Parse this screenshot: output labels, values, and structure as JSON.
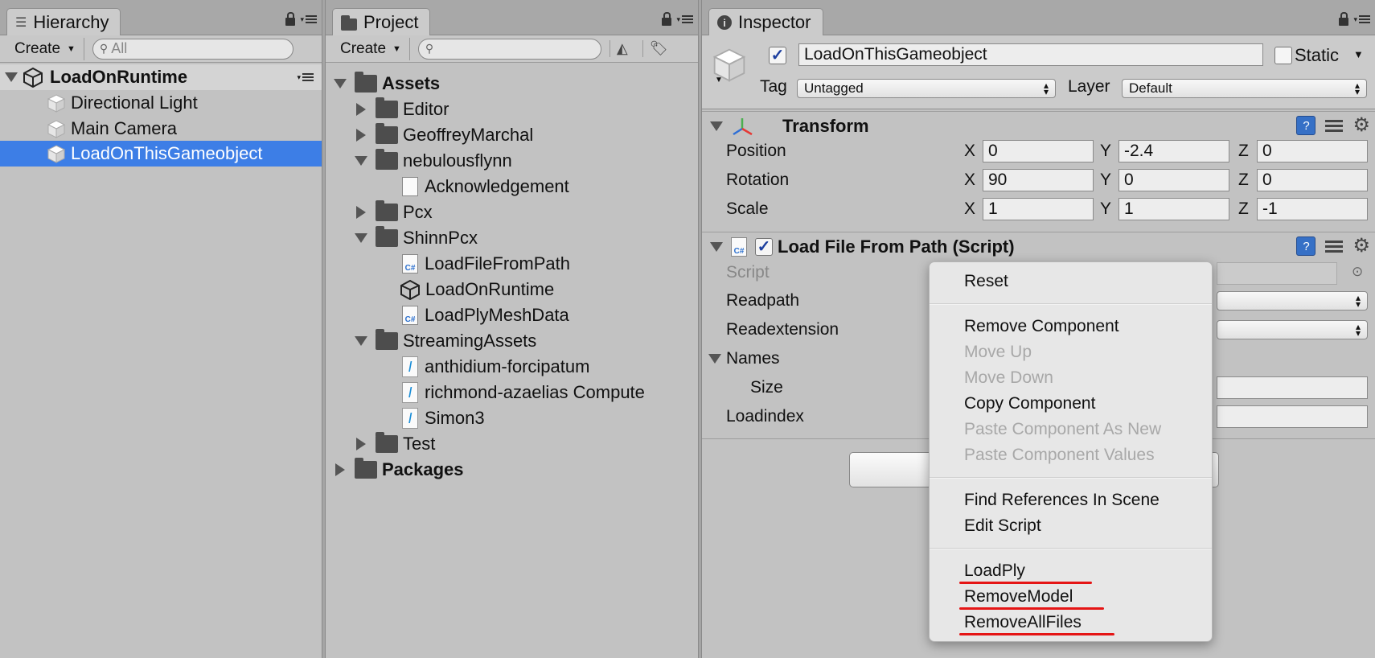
{
  "hierarchy": {
    "tab_label": "Hierarchy",
    "create_label": "Create",
    "search_placeholder": "All",
    "scene_name": "LoadOnRuntime",
    "items": [
      "Directional Light",
      "Main Camera",
      "LoadOnThisGameobject"
    ],
    "selected_index": 2
  },
  "project": {
    "tab_label": "Project",
    "create_label": "Create",
    "tree": [
      {
        "label": "Assets",
        "bold": true
      },
      {
        "label": "Editor"
      },
      {
        "label": "GeoffreyMarchal"
      },
      {
        "label": "nebulousflynn"
      },
      {
        "label": "Acknowledgement"
      },
      {
        "label": "Pcx"
      },
      {
        "label": "ShinnPcx"
      },
      {
        "label": "LoadFileFromPath"
      },
      {
        "label": "LoadOnRuntime"
      },
      {
        "label": "LoadPlyMeshData"
      },
      {
        "label": "StreamingAssets"
      },
      {
        "label": "anthidium-forcipatum"
      },
      {
        "label": "richmond-azaelias Compute"
      },
      {
        "label": "Simon3"
      },
      {
        "label": "Test"
      },
      {
        "label": "Packages",
        "bold": true
      }
    ]
  },
  "inspector": {
    "tab_label": "Inspector",
    "object_name": "LoadOnThisGameobject",
    "active": true,
    "static_label": "Static",
    "static_checked": false,
    "tag_label": "Tag",
    "tag_value": "Untagged",
    "layer_label": "Layer",
    "layer_value": "Default",
    "transform": {
      "title": "Transform",
      "axes": [
        "X",
        "Y",
        "Z"
      ],
      "rows": [
        {
          "label": "Position",
          "values": [
            "0",
            "-2.4",
            "0"
          ]
        },
        {
          "label": "Rotation",
          "values": [
            "90",
            "0",
            "0"
          ]
        },
        {
          "label": "Scale",
          "values": [
            "1",
            "1",
            "-1"
          ]
        }
      ]
    },
    "script_component": {
      "title": "Load File From Path (Script)",
      "enabled": true,
      "fields": [
        "Script",
        "Readpath",
        "Readextension",
        "Names",
        "Size",
        "Loadindex"
      ]
    }
  },
  "context_menu": {
    "items": [
      {
        "label": "Reset",
        "enabled": true
      },
      {
        "label": "Remove Component",
        "enabled": true
      },
      {
        "label": "Move Up",
        "enabled": false
      },
      {
        "label": "Move Down",
        "enabled": false
      },
      {
        "label": "Copy Component",
        "enabled": true
      },
      {
        "label": "Paste Component As New",
        "enabled": false
      },
      {
        "label": "Paste Component Values",
        "enabled": false
      },
      {
        "label": "Find References In Scene",
        "enabled": true
      },
      {
        "label": "Edit Script",
        "enabled": true
      },
      {
        "label": "LoadPly",
        "enabled": true,
        "highlighted": true
      },
      {
        "label": "RemoveModel",
        "enabled": true,
        "highlighted": true
      },
      {
        "label": "RemoveAllFiles",
        "enabled": true,
        "highlighted": true
      }
    ]
  },
  "colors": {
    "selection": "#3d7ee6",
    "panel_bg": "#c2c2c2",
    "annotation_underline": "#e51515"
  }
}
